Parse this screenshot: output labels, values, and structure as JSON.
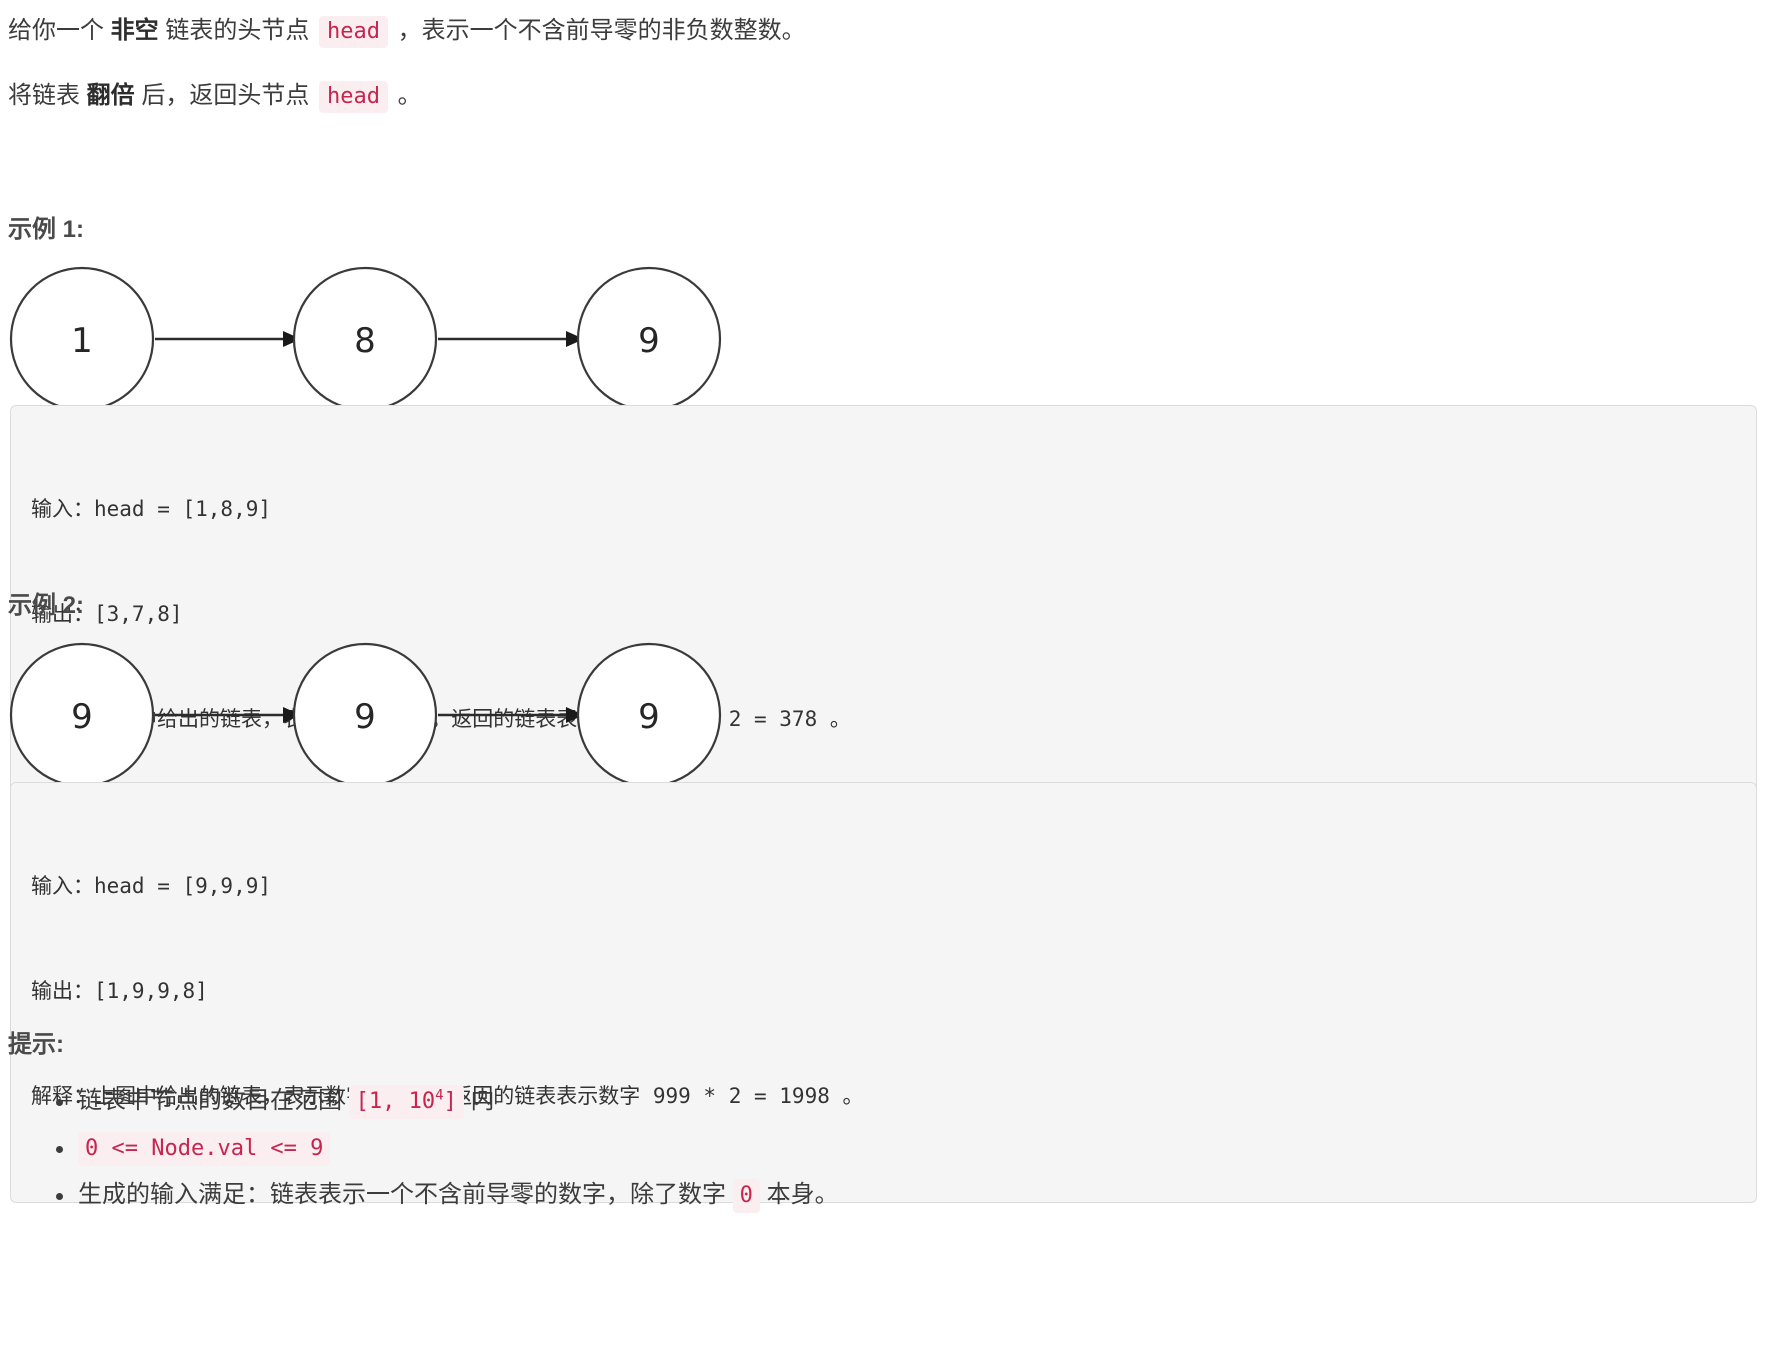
{
  "problem": {
    "paragraphs": [
      {
        "id": "p1",
        "segments": [
          {
            "type": "text",
            "text": "给你一个 "
          },
          {
            "type": "bold",
            "text": "非空"
          },
          {
            "type": "text",
            "text": " 链表的头节点 "
          },
          {
            "type": "code",
            "text": "head"
          },
          {
            "type": "text",
            "text": " ，表示一个不含前导零的非负数整数。"
          }
        ]
      },
      {
        "id": "p2",
        "segments": [
          {
            "type": "text",
            "text": "将链表 "
          },
          {
            "type": "bold",
            "text": "翻倍"
          },
          {
            "type": "text",
            "text": " 后，返回头节点 "
          },
          {
            "type": "code",
            "text": "head"
          },
          {
            "type": "text",
            "text": " 。"
          }
        ]
      }
    ],
    "p1_lead": "给你一个 ",
    "p1_bold": "非空",
    "p1_mid": " 链表的头节点 ",
    "p1_code": "head",
    "p1_tail": " ，表示一个不含前导零的非负数整数。",
    "p2_lead": "将链表 ",
    "p2_bold": "翻倍",
    "p2_mid": " 后，返回头节点 ",
    "p2_code": "head",
    "p2_tail": " 。"
  },
  "examples": [
    {
      "heading": "示例 1:",
      "diagram": {
        "type": "linked-list",
        "nodes": [
          "1",
          "8",
          "9"
        ]
      },
      "input_label": "输入：",
      "input_value": "head = [1,8,9]",
      "output_label": "输出：",
      "output_value": "[3,7,8]",
      "explain_label": "解释：",
      "explain_value": "上图中给出的链表，表示数字 189 。返回的链表表示数字 189 * 2 = 378 。"
    },
    {
      "heading": "示例 2:",
      "diagram": {
        "type": "linked-list",
        "nodes": [
          "9",
          "9",
          "9"
        ]
      },
      "input_label": "输入：",
      "input_value": "head = [9,9,9]",
      "output_label": "输出：",
      "output_value": "[1,9,9,8]",
      "explain_label": "解释：",
      "explain_value": "上图中给出的链表，表示数字 999 。返回的链表表示数字 999 * 2 = 1998 。"
    }
  ],
  "constraints": {
    "heading": "提示:",
    "items": [
      {
        "lead": "链表中节点的数目在范围 ",
        "code_base": "[1, 10",
        "code_sup": "4",
        "code_rest": "]",
        "tail": " 内"
      },
      {
        "lead": "",
        "code_base": "0 <= Node.val <= 9",
        "code_sup": "",
        "code_rest": "",
        "tail": ""
      },
      {
        "lead": "生成的输入满足：链表表示一个不含前导零的数字，除了数字 ",
        "code_base": "0",
        "code_sup": "",
        "code_rest": "",
        "tail": " 本身。"
      }
    ]
  },
  "colors": {
    "text": "#3c3c3c",
    "code_text": "#c7254e",
    "code_bg": "#fbeef0",
    "block_bg": "#f5f5f5",
    "block_border": "#dcdcdc",
    "node_stroke": "#3a3a3a",
    "arrow": "#2b2b2b"
  }
}
